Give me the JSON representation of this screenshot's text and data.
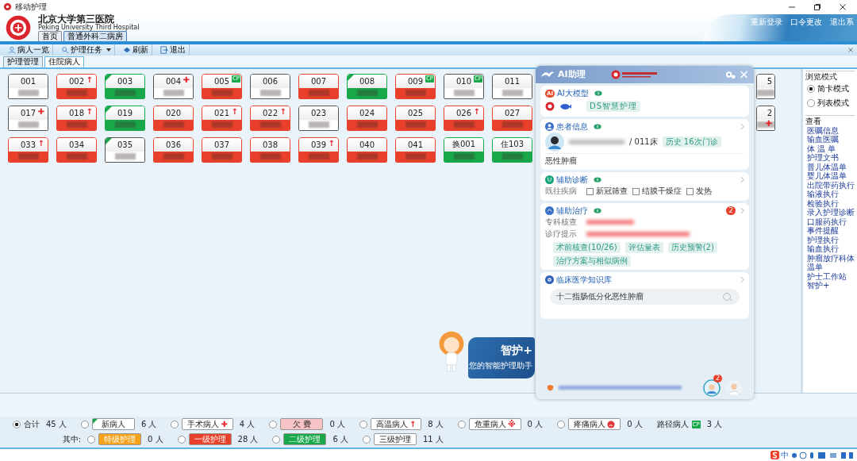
{
  "window": {
    "title": "移动护理",
    "header_links": [
      "重新登录",
      "口令更改",
      "退出系"
    ]
  },
  "hospital": {
    "name": "北京大学第三医院",
    "english": "Peking University Third Hospital"
  },
  "nav_tabs": [
    {
      "label": "首页",
      "selected": false
    },
    {
      "label": "普通外科二病房",
      "selected": true
    }
  ],
  "toolbar": [
    {
      "label": "病人一览",
      "kind": "patients",
      "dropdown": false
    },
    {
      "label": "护理任务",
      "kind": "tasks",
      "dropdown": true
    },
    {
      "label": "刷新",
      "kind": "refresh",
      "dropdown": false
    },
    {
      "label": "退出",
      "kind": "exit",
      "dropdown": false
    }
  ],
  "sub_tabs": [
    {
      "label": "护理管理",
      "selected": false
    },
    {
      "label": "住院病人",
      "selected": true
    }
  ],
  "beds": [
    [
      {
        "number": "001",
        "color": "#ffffff",
        "new": false
      },
      {
        "number": "002",
        "color": "#e8402a",
        "new": false,
        "marker": "↑"
      },
      {
        "number": "003",
        "color": "#18a84a",
        "new": true
      },
      {
        "number": "004",
        "color": "#ffffff",
        "new": false,
        "marker": "✚"
      },
      {
        "number": "005",
        "color": "#e8402a",
        "new": false,
        "badge": "CP"
      },
      {
        "number": "006",
        "color": "#ffffff",
        "new": false
      },
      {
        "number": "007",
        "color": "#e8402a",
        "new": false
      },
      {
        "number": "008",
        "color": "#18a84a",
        "new": true
      },
      {
        "number": "009",
        "color": "#e8402a",
        "new": false,
        "badge": "CP"
      },
      {
        "number": "010",
        "color": "#ffffff",
        "new": false,
        "badge": "CP"
      },
      {
        "number": "011",
        "color": "#ffffff",
        "new": false
      },
      {
        "number": "5",
        "color": "#ffffff",
        "new": false,
        "partial": true
      }
    ],
    [
      {
        "number": "017",
        "color": "#ffffff",
        "new": false,
        "marker": "✚"
      },
      {
        "number": "018",
        "color": "#e8402a",
        "new": false,
        "marker": "↑"
      },
      {
        "number": "019",
        "color": "#18a84a",
        "new": true
      },
      {
        "number": "020",
        "color": "#e8402a",
        "new": false
      },
      {
        "number": "021",
        "color": "#e8402a",
        "new": false,
        "marker": "↑"
      },
      {
        "number": "022",
        "color": "#e8402a",
        "new": false,
        "marker": "↑"
      },
      {
        "number": "023",
        "color": "#ffffff",
        "new": false
      },
      {
        "number": "024",
        "color": "#e8402a",
        "new": false
      },
      {
        "number": "025",
        "color": "#e8402a",
        "new": false
      },
      {
        "number": "026",
        "color": "#e8402a",
        "new": false,
        "marker": "↑"
      },
      {
        "number": "027",
        "color": "#e8402a",
        "new": false
      },
      {
        "number": "2",
        "color": "#ffffff",
        "new": false,
        "marker": "✚",
        "partial": true
      }
    ],
    [
      {
        "number": "033",
        "color": "#e8402a",
        "new": false,
        "marker": "↑"
      },
      {
        "number": "034",
        "color": "#e8402a",
        "new": false
      },
      {
        "number": "035",
        "color": "#ffffff",
        "new": true
      },
      {
        "number": "036",
        "color": "#e8402a",
        "new": false
      },
      {
        "number": "037",
        "color": "#e8402a",
        "new": false
      },
      {
        "number": "038",
        "color": "#e8402a",
        "new": false
      },
      {
        "number": "039",
        "color": "#e8402a",
        "new": false,
        "marker": "↑"
      },
      {
        "number": "040",
        "color": "#e8402a",
        "new": false
      },
      {
        "number": "041",
        "color": "#e8402a",
        "new": false
      },
      {
        "number": "换001",
        "color": "#18a84a",
        "new": false
      },
      {
        "number": "住103",
        "color": "#18a84a",
        "new": false
      }
    ]
  ],
  "ai_panel": {
    "title": "AI助理",
    "sections": [
      {
        "kind": "model",
        "title": "AI大模型",
        "icon_text": "AI",
        "chip": "DS智慧护理"
      },
      {
        "kind": "patient",
        "title": "患者信息",
        "bed": "/ 011床",
        "chip": "历史 16次门诊",
        "diagnosis": "恶性肿瘤"
      },
      {
        "kind": "diagnosis",
        "title": "辅助诊断",
        "label": "既往疾病",
        "options": [
          {
            "label": "新冠筛查",
            "checked": false
          },
          {
            "label": "结膜干燥症",
            "checked": false
          },
          {
            "label": "发热",
            "checked": false
          }
        ]
      },
      {
        "kind": "treatment",
        "title": "辅助治疗",
        "badge": "2",
        "rows": [
          "专科核查",
          "诊疗提示"
        ],
        "chips": [
          "术前核查(10/26)",
          "评估量表",
          "历史预警(2)",
          "治疗方案与相似病例"
        ]
      },
      {
        "kind": "knowledge",
        "title": "临床医学知识库",
        "query": "十二指肠低分化恶性肿瘤"
      }
    ],
    "footer_badge": "2"
  },
  "mascot": {
    "title": "智护+",
    "subtitle": "您的智能护理助手"
  },
  "sidebar": {
    "mode_title": "浏览模式",
    "modes": [
      {
        "label": "简卡模式",
        "selected": true
      },
      {
        "label": "列表模式",
        "selected": false
      }
    ],
    "view_title": "查看",
    "links": [
      "医嘱信息",
      "输血医嘱",
      "体 温 单",
      "护理文书",
      "普儿体温单",
      "婴儿体温单",
      "出院带药执行",
      "输液执行",
      "检验执行",
      "录入护理诊断",
      "口服药执行",
      "事件提醒",
      "护理执行",
      "输血执行",
      "肿瘤放疗科体温单",
      "护士工作站",
      "智护+"
    ]
  },
  "legend": {
    "rows": [
      {
        "items": [
          {
            "label": "合计",
            "count": "45 人",
            "selected": true,
            "kind": "plain"
          },
          {
            "label": "新病人",
            "count": "6 人",
            "selected": false,
            "kind": "tag",
            "color": "#ffffff",
            "corner": true
          },
          {
            "label": "手术病人",
            "count": "4 人",
            "selected": false,
            "kind": "tag",
            "color": "#ffffff",
            "marker": "✚"
          },
          {
            "label": "欠 费",
            "count": "0 人",
            "selected": false,
            "kind": "tag",
            "color": "#f6c4c4"
          },
          {
            "label": "高温病人",
            "count": "8 人",
            "selected": false,
            "kind": "tag",
            "color": "#ffffff",
            "marker": "↑"
          },
          {
            "label": "危重病人",
            "count": "0 人",
            "selected": false,
            "kind": "tag",
            "color": "#ffffff",
            "marker": "※"
          },
          {
            "label": "疼痛病人",
            "count": "0 人",
            "selected": false,
            "kind": "tag-icon",
            "color": "#ffffff"
          },
          {
            "label": "路径病人",
            "count": "3 人",
            "kind": "badge",
            "badge": "CP"
          }
        ]
      },
      {
        "heading": "其中:",
        "items": [
          {
            "label": "特级护理",
            "count": "0 人",
            "selected": false,
            "kind": "tag",
            "color": "#f7a21b"
          },
          {
            "label": "一级护理",
            "count": "28 人",
            "selected": false,
            "kind": "tag",
            "color": "#e8402a"
          },
          {
            "label": "二级护理",
            "count": "6 人",
            "selected": false,
            "kind": "tag",
            "color": "#18a84a"
          },
          {
            "label": "三级护理",
            "count": "11 人",
            "selected": false,
            "kind": "tag",
            "color": "#ffffff"
          }
        ]
      }
    ]
  },
  "ime": {
    "label": "中"
  }
}
